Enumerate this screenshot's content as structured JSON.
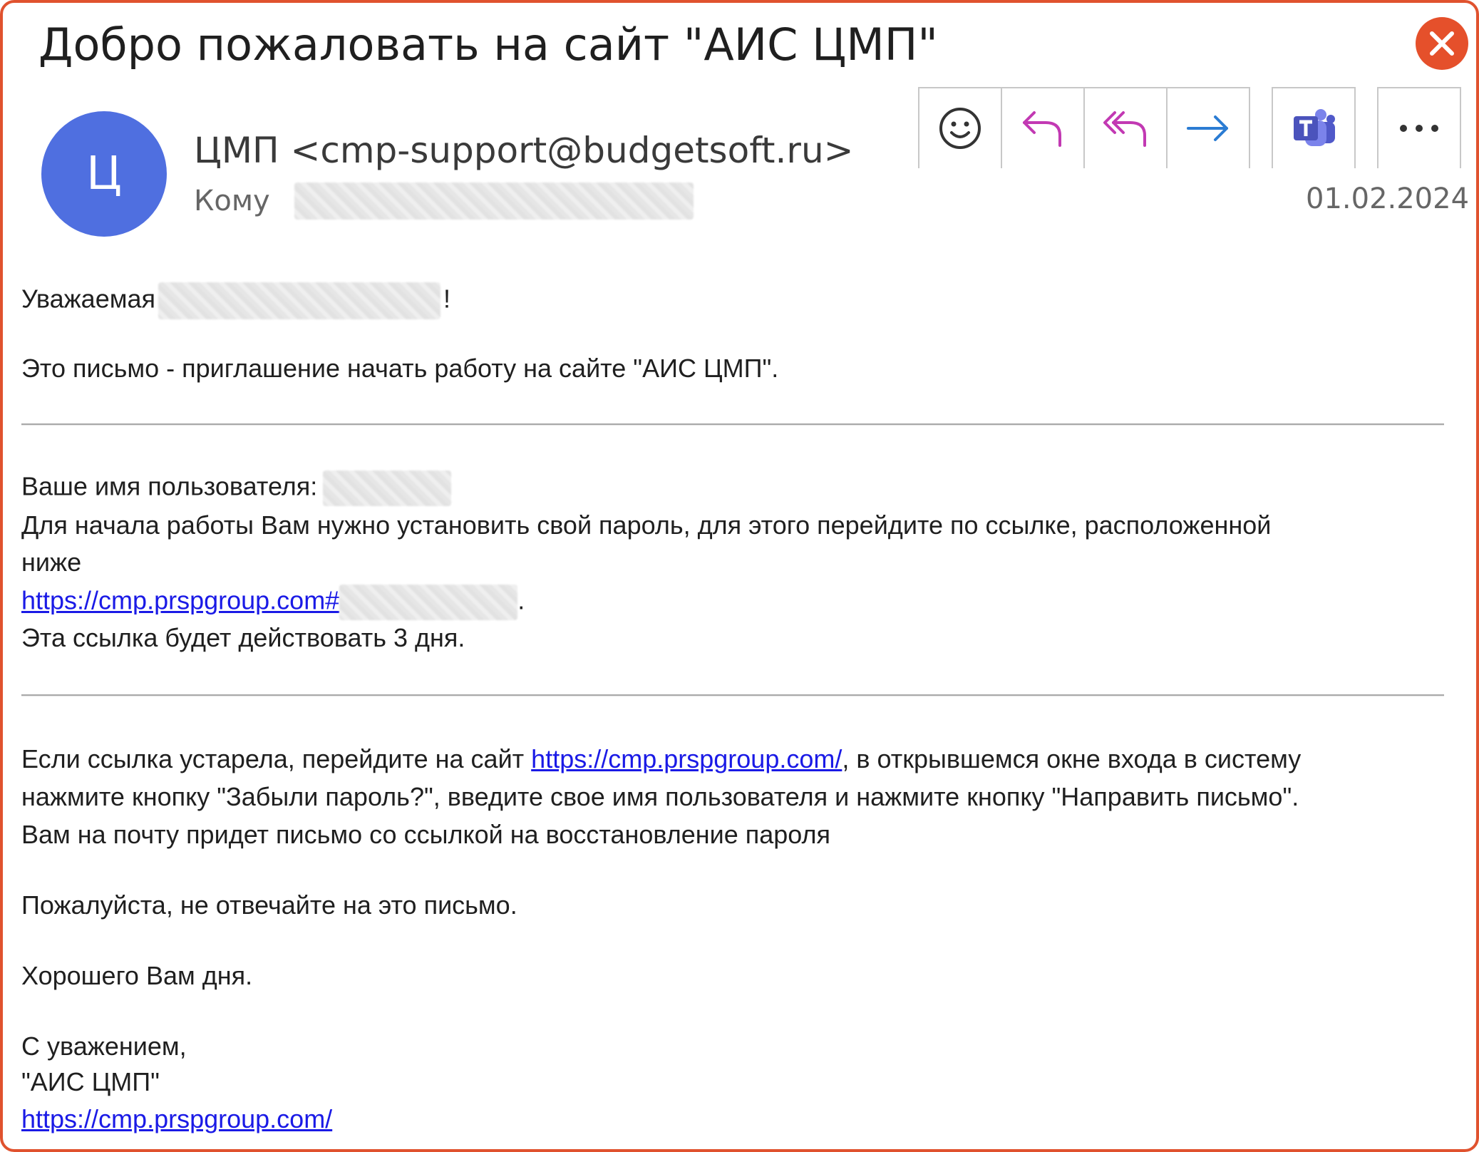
{
  "header": {
    "subject": "Добро пожаловать на сайт \"АИС ЦМП\"",
    "avatar_initial": "Ц",
    "sender": "ЦМП <cmp-support@budgetsoft.ru>",
    "to_label": "Кому",
    "date": "01.02.2024"
  },
  "toolbar": {
    "buttons": [
      {
        "icon": "smiley-icon"
      },
      {
        "icon": "reply-icon"
      },
      {
        "icon": "reply-all-icon"
      },
      {
        "icon": "forward-icon"
      },
      {
        "icon": "teams-icon"
      },
      {
        "icon": "more-icon"
      }
    ],
    "accent_color": "#c239b3",
    "forward_color": "#2b7cd3"
  },
  "body": {
    "greeting_prefix": "Уважаемая",
    "greeting_suffix": "!",
    "intro": "Это письмо - приглашение начать работу на сайте \"АИС ЦМП\".",
    "username_label": "Ваше имя пользователя:",
    "instruction_line1": "Для начала работы Вам нужно установить свой пароль, для этого перейдите по ссылке, расположенной",
    "instruction_line2": "ниже",
    "reset_link": "https://cmp.prspgroup.com#",
    "reset_link_suffix": ".",
    "validity": "Эта ссылка будет действовать 3 дня.",
    "expired_prefix": "Если ссылка устарела, перейдите на сайт ",
    "site_link": "https://cmp.prspgroup.com/",
    "expired_suffix": ", в открывшемся окне входа в систему",
    "expired_line2": "нажмите кнопку \"Забыли пароль?\", введите свое имя пользователя и нажмите кнопку \"Направить письмо\".",
    "expired_line3": "Вам на почту придет письмо со ссылкой на восстановление пароля",
    "no_reply": "Пожалуйста, не отвечайте на это письмо.",
    "good_day": "Хорошего Вам дня.",
    "regards": "С уважением,",
    "signature_name": "\"АИС ЦМП\"",
    "signature_link": "https://cmp.prspgroup.com/"
  },
  "colors": {
    "close": "#e5502b",
    "avatar": "#4f6fe0",
    "link": "#1a1ae6"
  }
}
